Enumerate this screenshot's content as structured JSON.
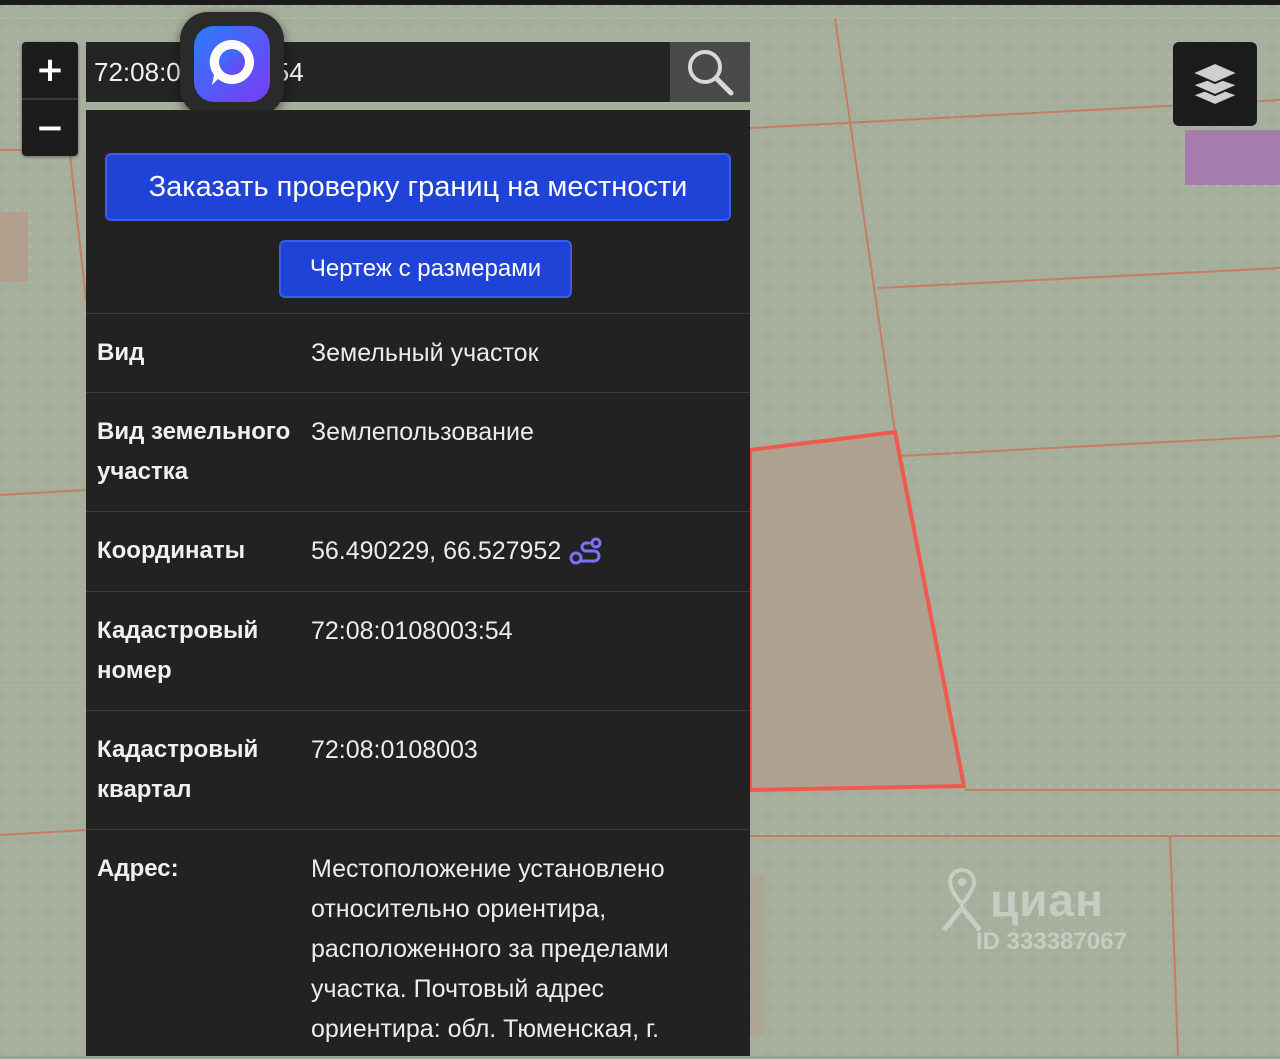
{
  "search": {
    "value": "72:08:0108003:54"
  },
  "zoom": {
    "in_label": "+",
    "out_label": "−"
  },
  "actions": {
    "order_check": "Заказать проверку границ на местности",
    "drawing": "Чертеж с размерами"
  },
  "details": [
    {
      "key": "Вид",
      "value": "Земельный участок"
    },
    {
      "key": "Вид земельного участка",
      "value": "Землепользование"
    },
    {
      "key": "Координаты",
      "value": "56.490229, 66.527952"
    },
    {
      "key": "Кадастровый номер",
      "value": "72:08:0108003:54"
    },
    {
      "key": "Кадастровый квартал",
      "value": "72:08:0108003"
    },
    {
      "key": "Адрес:",
      "value": "Местоположение установлено относительно ориентира, расположенного за пределами участка. Почтовый адрес ориентира: обл. Тюменская, г."
    }
  ],
  "watermark": {
    "brand": "циан",
    "id": "ID 333387067"
  },
  "colors": {
    "accent": "#1f43d6",
    "panel": "#222223",
    "parcel_outline": "#f05a4e"
  },
  "icons": [
    "search-icon",
    "layers-icon",
    "route-icon",
    "app-logo-icon",
    "location-pin-icon"
  ]
}
